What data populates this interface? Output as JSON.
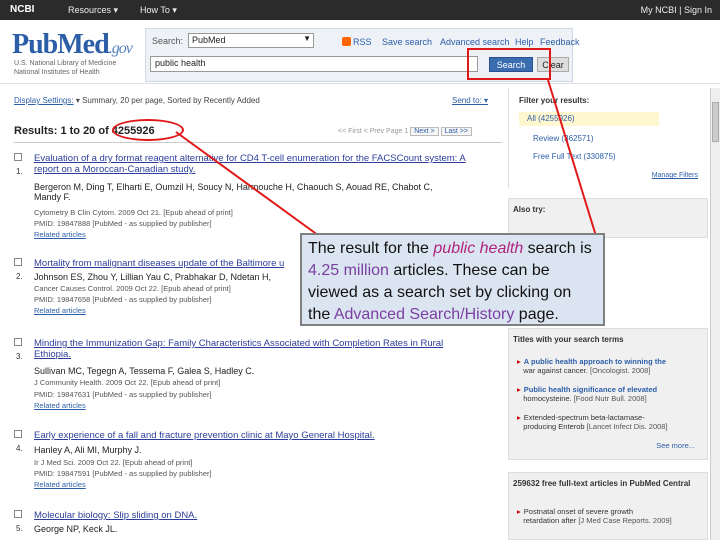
{
  "topbar": {
    "ncbi": "NCBI",
    "resources": "Resources",
    "howto": "How To",
    "account": "My NCBI | Sign In"
  },
  "header": {
    "logo_pub": "Pub",
    "logo_med": "Med",
    "logo_gov": ".gov",
    "sub1": "U.S. National Library of Medicine",
    "sub2": "National Institutes of Health",
    "search_label": "Search:",
    "database": "PubMed",
    "rss": "RSS",
    "save_search": "Save search",
    "advanced_search": "Advanced search",
    "help": "Help",
    "feedback": "Feedback",
    "query": "public health",
    "search_btn": "Search",
    "clear_btn": "Clear"
  },
  "display": {
    "label": "Display Settings:",
    "settings": "Summary, 20 per page, Sorted by Recently Added",
    "send_to": "Send to:"
  },
  "results": {
    "prefix": "Results: 1 to 20 of ",
    "count": "4255926",
    "pager": "<< First  < Prev  Page 1",
    "next": "Next >",
    "last": "Last >>"
  },
  "items": [
    {
      "num": "1.",
      "title_1": "Evaluation of a dry format reagent alternative for CD4 T-cell enumeration for the FACSCount system: A",
      "title_2": "report on a Moroccan-Canadian study.",
      "authors_1": "Bergeron M, Ding T, Elharti E, Oumzil H, Soucy N, Harmouche H, Chaouch S, Aouad RE, Chabot C,",
      "authors_2": "Mandy F.",
      "journal": "Cytometry B Clin Cytom. 2009 Oct 21. [Epub ahead of print]",
      "pmid": "PMID: 19847888 [PubMed - as supplied by publisher]",
      "related": "Related articles"
    },
    {
      "num": "2.",
      "title_1": "Mortality from malignant diseases update of the Baltimore u",
      "authors_1": "Johnson ES, Zhou Y, Lillian Yau C, Prabhakar D, Ndetan H,",
      "journal": "Cancer Causes Control. 2009 Oct 22. [Epub ahead of print]",
      "pmid": "PMID: 19847658 [PubMed - as supplied by publisher]",
      "related": "Related articles"
    },
    {
      "num": "3.",
      "title_1": "Minding the Immunization Gap: Family Characteristics Associated with Completion Rates in Rural",
      "title_2": "Ethiopia.",
      "authors_1": "Sullivan MC, Tegegn A, Tessema F, Galea S, Hadley C.",
      "journal": "J Community Health. 2009 Oct 22. [Epub ahead of print]",
      "pmid": "PMID: 19847631 [PubMed - as supplied by publisher]",
      "related": "Related articles"
    },
    {
      "num": "4.",
      "title_1": "Early experience of a fall and fracture prevention clinic at Mayo General Hospital.",
      "authors_1": "Hanley A, Ali MI, Murphy J.",
      "journal": "Ir J Med Sci. 2009 Oct 22. [Epub ahead of print]",
      "pmid": "PMID: 19847591 [PubMed - as supplied by publisher]",
      "related": "Related articles"
    },
    {
      "num": "5.",
      "title_1": "Molecular biology: Slip sliding on DNA.",
      "authors_1": "George NP, Keck JL."
    }
  ],
  "filters": {
    "heading": "Filter your results:",
    "all": "All (4255926)",
    "review": "Review (362571)",
    "free": "Free Full Text (330875)",
    "manage": "Manage Filters"
  },
  "also_try": {
    "heading": "Also try:"
  },
  "titles_box": {
    "heading": "Titles with your search terms",
    "item1_a": "A public health approach to winning the",
    "item1_b": "war against cancer.",
    "item1_ref": "[Oncologist. 2008]",
    "item2_a": "Public health significance of elevated",
    "item2_b": "homocysteine.",
    "item2_ref": "[Food Nutr Bull. 2008]",
    "item3_a": "Extended-spectrum beta-lactamase-",
    "item3_b": "producing Enterob",
    "item3_ref": "[Lancet Infect Dis. 2008]",
    "more": "See more..."
  },
  "fulltext_box": {
    "heading": "259632 free full-text articles in PubMed Central",
    "item1_a": "Postnatal onset of severe growth",
    "item1_b": "retardation after",
    "item1_ref": "[J Med Case Reports. 2009]"
  },
  "annotation": {
    "p1": "The result for the ",
    "p2": "public health",
    "p3": " search is ",
    "p4": "4.25 million",
    "p5": " articles. These can be viewed as a search set by clicking on the ",
    "p6": "Advanced Search/History",
    "p7": "  page."
  },
  "colors": {
    "link": "#2c5ea8",
    "annotation_red": "#e01818",
    "callout_bg": "#dbe5f1"
  }
}
